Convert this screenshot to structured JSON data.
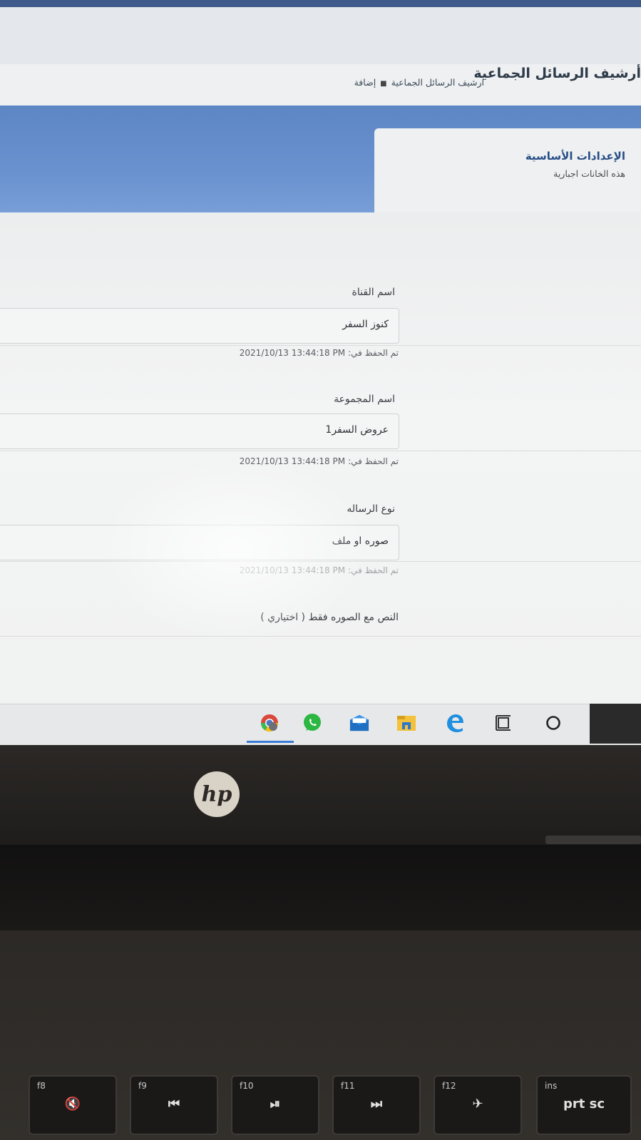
{
  "header": {
    "page_title": "أرشيف الرسائل الجماعية",
    "breadcrumb": {
      "item1": "ارشيف الرسائل الجماعية",
      "item2": "إضافة"
    }
  },
  "section": {
    "title": "الإعدادات الأساسية",
    "subtitle": "هذه الخانات اجبارية"
  },
  "form": {
    "fields": [
      {
        "label": "اسم القناة",
        "value": "كنوز السفر",
        "saved_prefix": "تم الحفظ في:",
        "saved_stamp": "2021/10/13 13:44:18 PM"
      },
      {
        "label": "اسم المجموعة",
        "value": "عروض السفر1",
        "saved_prefix": "تم الحفظ في:",
        "saved_stamp": "2021/10/13 13:44:18 PM"
      },
      {
        "label": "نوع الرساله",
        "value": "صوره او ملف",
        "saved_prefix": "تم الحفظ في:",
        "saved_stamp": "2021/10/13 13:44:18 PM"
      }
    ],
    "optional_label": "النص مع الصوره فقط ( اختياري )"
  },
  "taskbar": {
    "icons": [
      "chrome-profile-icon",
      "whatsapp-icon",
      "mail-icon",
      "file-explorer-icon",
      "edge-icon",
      "task-view-icon",
      "cortana-icon"
    ]
  },
  "laptop": {
    "logo": "hp",
    "keys": [
      {
        "fn": "f8",
        "glyph": "🔇"
      },
      {
        "fn": "f9",
        "glyph": "⏮"
      },
      {
        "fn": "f10",
        "glyph": "⏯"
      },
      {
        "fn": "f11",
        "glyph": "⏭"
      },
      {
        "fn": "f12",
        "glyph": "✈"
      },
      {
        "fn": "ins",
        "glyph": "prt sc"
      }
    ]
  },
  "colors": {
    "accent_blue": "#5d86c4",
    "section_title": "#264d86",
    "taskbar": "#e6e8ea"
  }
}
